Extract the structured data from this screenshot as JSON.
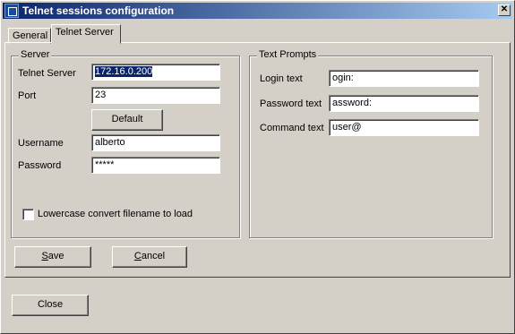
{
  "window": {
    "title": "Telnet sessions configuration",
    "close_glyph": "✕"
  },
  "tabs": [
    {
      "label": "General"
    },
    {
      "label": "Telnet Server",
      "active": true
    }
  ],
  "server_group": {
    "legend": "Server",
    "telnet_server_label": "Telnet Server",
    "telnet_server_value": "172.16.0.200",
    "port_label": "Port",
    "port_value": "23",
    "default_button": "Default",
    "username_label": "Username",
    "username_value": "alberto",
    "password_label": "Password",
    "password_value": "*****",
    "lowercase_label": "Lowercase convert filename to load",
    "lowercase_checked": false
  },
  "prompts_group": {
    "legend": "Text Prompts",
    "login_label": "Login text",
    "login_value": "ogin:",
    "password_label": "Password text",
    "password_value": "assword:",
    "command_label": "Command text",
    "command_value": "user@"
  },
  "buttons": {
    "save": {
      "mnemonic": "S",
      "rest": "ave"
    },
    "cancel": {
      "mnemonic": "C",
      "rest": "ancel"
    },
    "close": "Close"
  }
}
